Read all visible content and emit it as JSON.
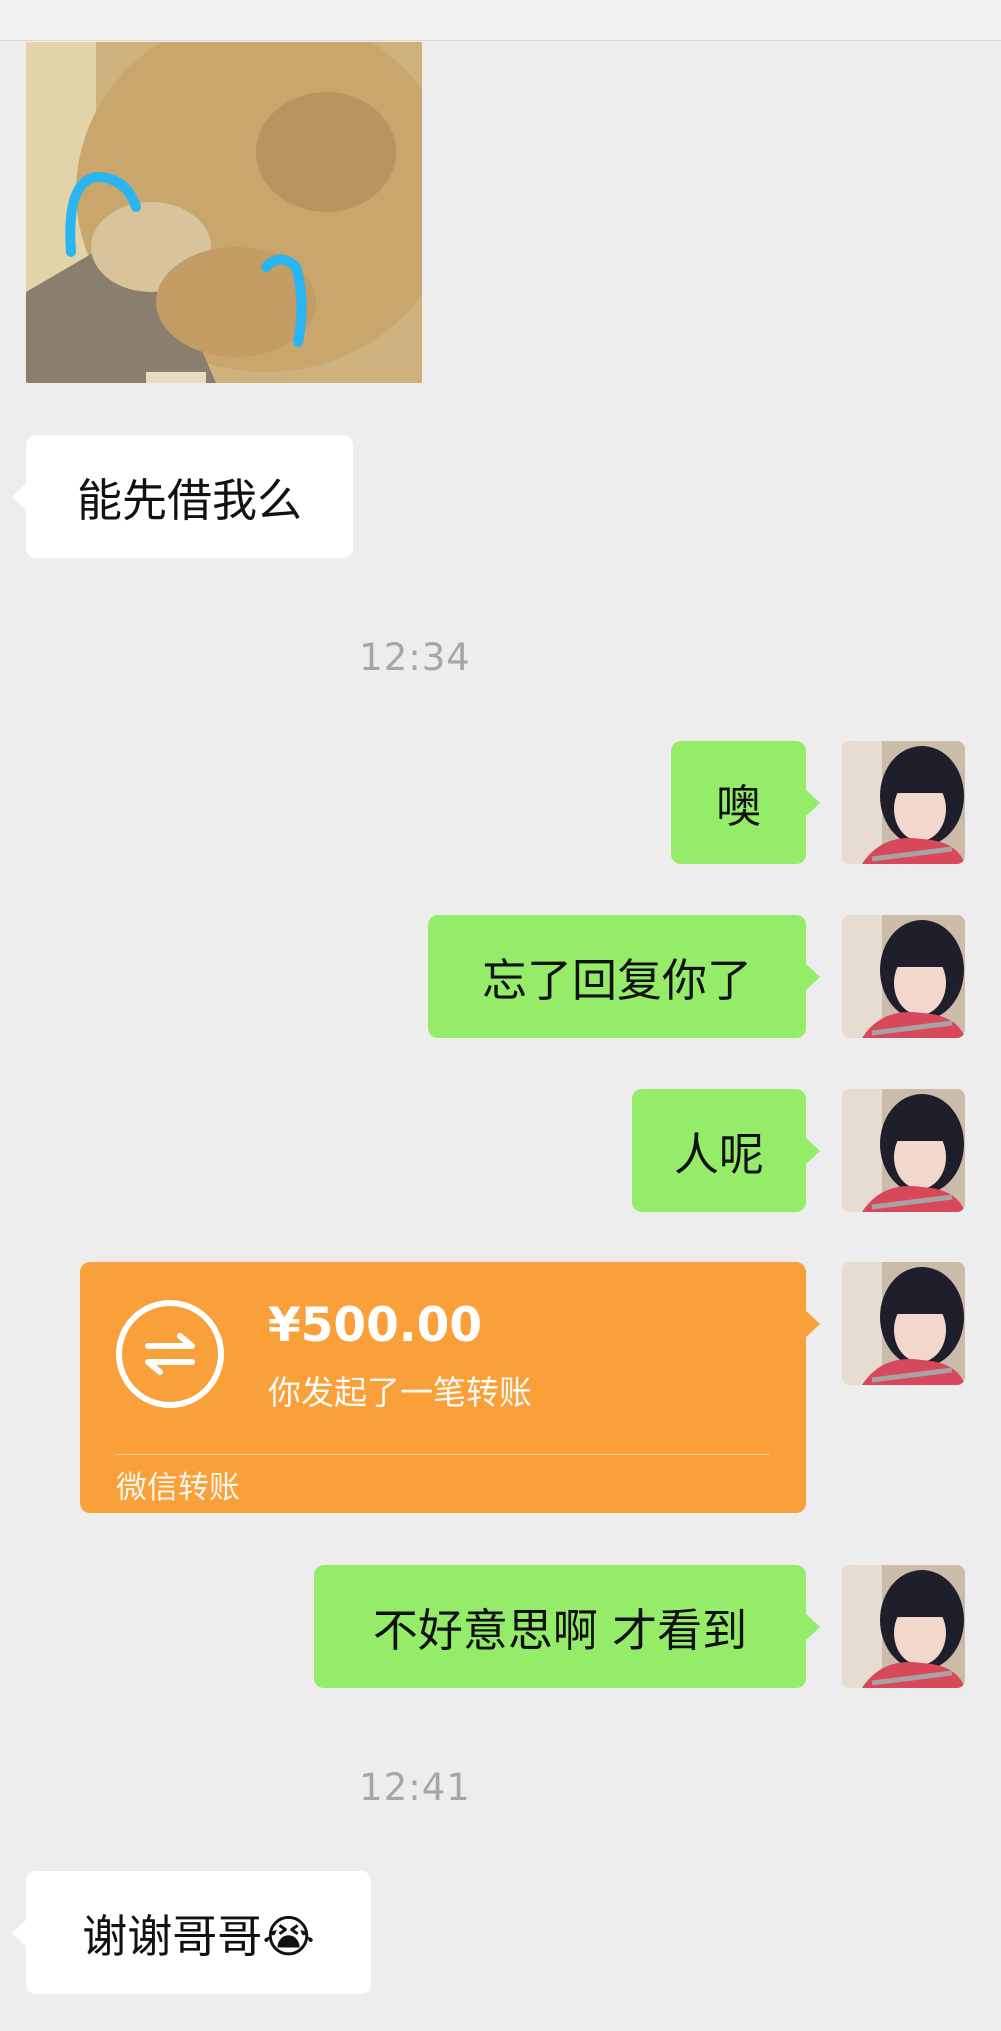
{
  "messages": {
    "m1": "能先借我么",
    "m2": "噢",
    "m3": "忘了回复你了",
    "m4": "人呢",
    "m5": "不好意思啊 才看到",
    "m6": "谢谢哥哥😭"
  },
  "timestamps": {
    "t1": "12:34",
    "t2": "12:41"
  },
  "transfer": {
    "amount": "¥500.00",
    "description": "你发起了一笔转账",
    "brand": "微信转账",
    "accent": "#f9a03a"
  },
  "colors": {
    "background": "#ededed",
    "sent_bubble": "#95ec69",
    "received_bubble": "#ffffff"
  }
}
